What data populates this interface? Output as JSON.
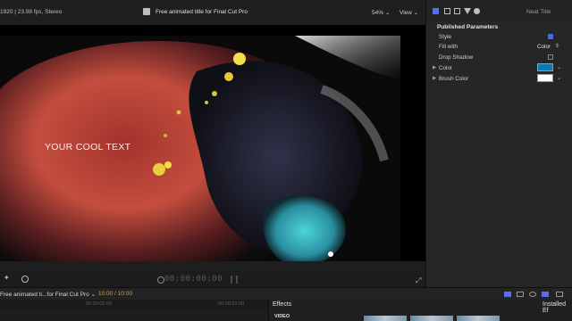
{
  "viewer_header": {
    "format_info": "1920 | 23.98 fps, Stereo",
    "title": "Free animated title for Final Cut Pro",
    "zoom": "54%",
    "view_label": "View"
  },
  "viewer": {
    "overlay_text": "YOUR COOL TEXT",
    "timecode": "00:00:00:00"
  },
  "inspector": {
    "title": "Neat Title",
    "section": "Published Parameters",
    "rows": {
      "style": {
        "label": "Style",
        "checked": true
      },
      "fill_with": {
        "label": "Fill with",
        "value": "Color"
      },
      "drop_shadow": {
        "label": "Drop Shadow",
        "checked": false
      },
      "color": {
        "label": "Color",
        "swatch": "#0b79b8"
      },
      "brush_color": {
        "label": "Brush Color",
        "swatch": "#ffffff"
      }
    }
  },
  "timeline": {
    "project": "Free animated ti...for Final Cut Pro",
    "duration": "10:00 / 10:00",
    "ruler": [
      "00:00:05:00",
      "00:00:10:00"
    ]
  },
  "effects": {
    "title": "Effects",
    "installed": "Installed Ef",
    "category": "VIDEO"
  },
  "colors": {
    "accent": "#3f6ce0",
    "timecode_gold": "#c8a64a"
  }
}
